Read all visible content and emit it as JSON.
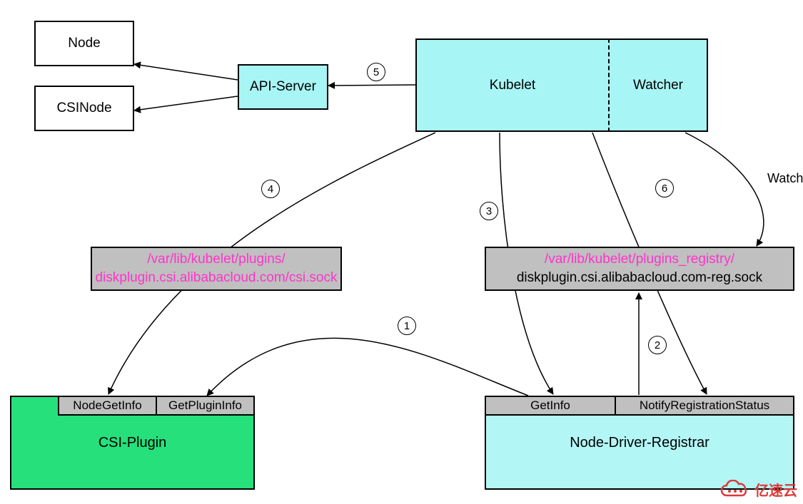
{
  "nodes": {
    "nodeBox": "Node",
    "csiNodeBox": "CSINode",
    "apiServer": "API-Server",
    "kubelet": "Kubelet",
    "watcher": "Watcher"
  },
  "sockets": {
    "left": {
      "path": "/var/lib/kubelet/plugins/",
      "file": "diskplugin.csi.alibabacloud.com/csi.sock"
    },
    "right": {
      "path": "/var/lib/kubelet/plugins_registry/",
      "file": "diskplugin.csi.alibabacloud.com-reg.sock"
    }
  },
  "services": {
    "csiPlugin": {
      "title": "CSI-Plugin",
      "endpoints": {
        "nodeGetInfo": "NodeGetInfo",
        "getPluginInfo": "GetPluginInfo"
      }
    },
    "nodeDriverRegistrar": {
      "title": "Node-Driver-Registrar",
      "endpoints": {
        "getInfo": "GetInfo",
        "notify": "NotifyRegistrationStatus"
      }
    }
  },
  "steps": {
    "s1": "1",
    "s2": "2",
    "s3": "3",
    "s4": "4",
    "s5": "5",
    "s6": "6"
  },
  "edgeLabels": {
    "watch": "Watch"
  },
  "watermark": "亿速云",
  "colors": {
    "cyan": "#a8f5f5",
    "cyanLight": "#b3f6f6",
    "green": "#26e07c",
    "grey": "#c0c0c0",
    "pink": "#ff33cc",
    "red": "#d93a3a"
  }
}
